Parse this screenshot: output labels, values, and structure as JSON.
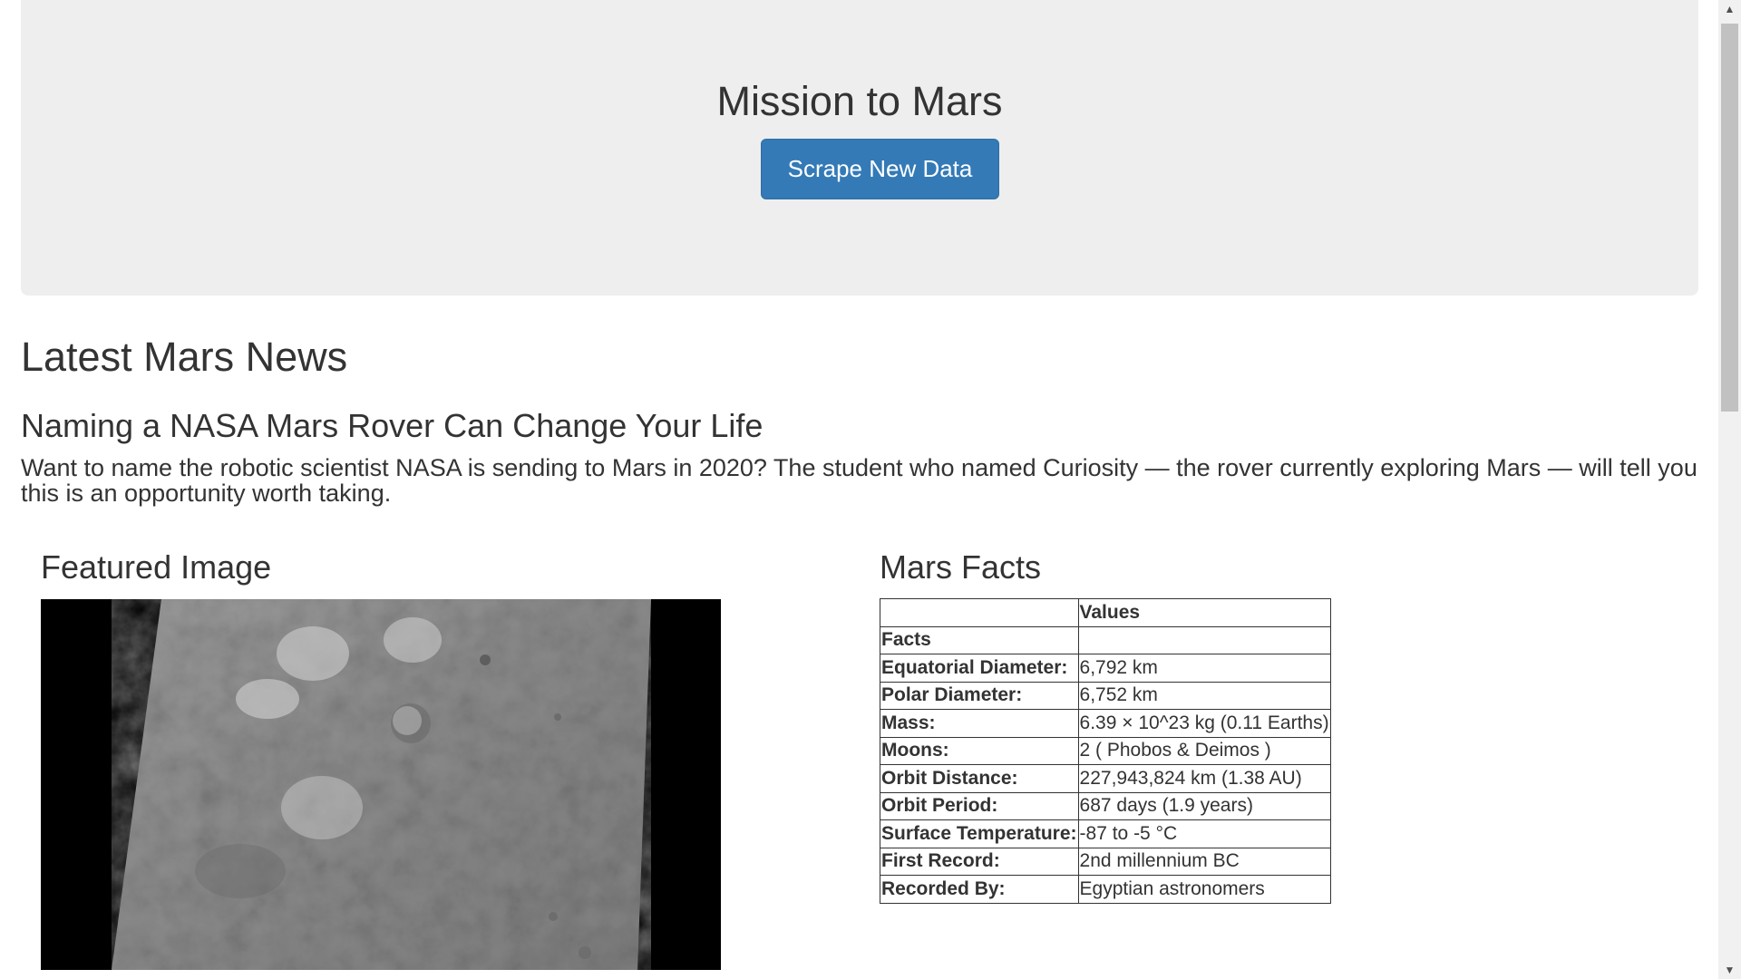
{
  "header": {
    "title": "Mission to Mars",
    "button_label": "Scrape New Data"
  },
  "news": {
    "heading": "Latest Mars News",
    "title": "Naming a NASA Mars Rover Can Change Your Life",
    "paragraph": "Want to name the robotic scientist NASA is sending to Mars in 2020? The student who named Curiosity — the rover currently exploring Mars — will tell you this is an opportunity worth taking."
  },
  "featured": {
    "heading": "Featured Image"
  },
  "facts": {
    "heading": "Mars Facts",
    "column_header": "Values",
    "index_label": "Facts",
    "rows": [
      {
        "key": "Equatorial Diameter:",
        "value": "6,792 km"
      },
      {
        "key": "Polar Diameter:",
        "value": "6,752 km"
      },
      {
        "key": "Mass:",
        "value": "6.39 × 10^23 kg (0.11 Earths)"
      },
      {
        "key": "Moons:",
        "value": "2 ( Phobos & Deimos )"
      },
      {
        "key": "Orbit Distance:",
        "value": "227,943,824 km (1.38 AU)"
      },
      {
        "key": "Orbit Period:",
        "value": "687 days (1.9 years)"
      },
      {
        "key": "Surface Temperature:",
        "value": "-87 to -5 °C"
      },
      {
        "key": "First Record:",
        "value": "2nd millennium BC"
      },
      {
        "key": "Recorded By:",
        "value": "Egyptian astronomers"
      }
    ]
  },
  "scrollbar": {
    "up_icon": "scroll-up-arrow-icon",
    "down_icon": "scroll-down-arrow-icon"
  },
  "colors": {
    "jumbotron_bg": "#eeeeee",
    "button_bg": "#337ab7",
    "text": "#333333"
  }
}
